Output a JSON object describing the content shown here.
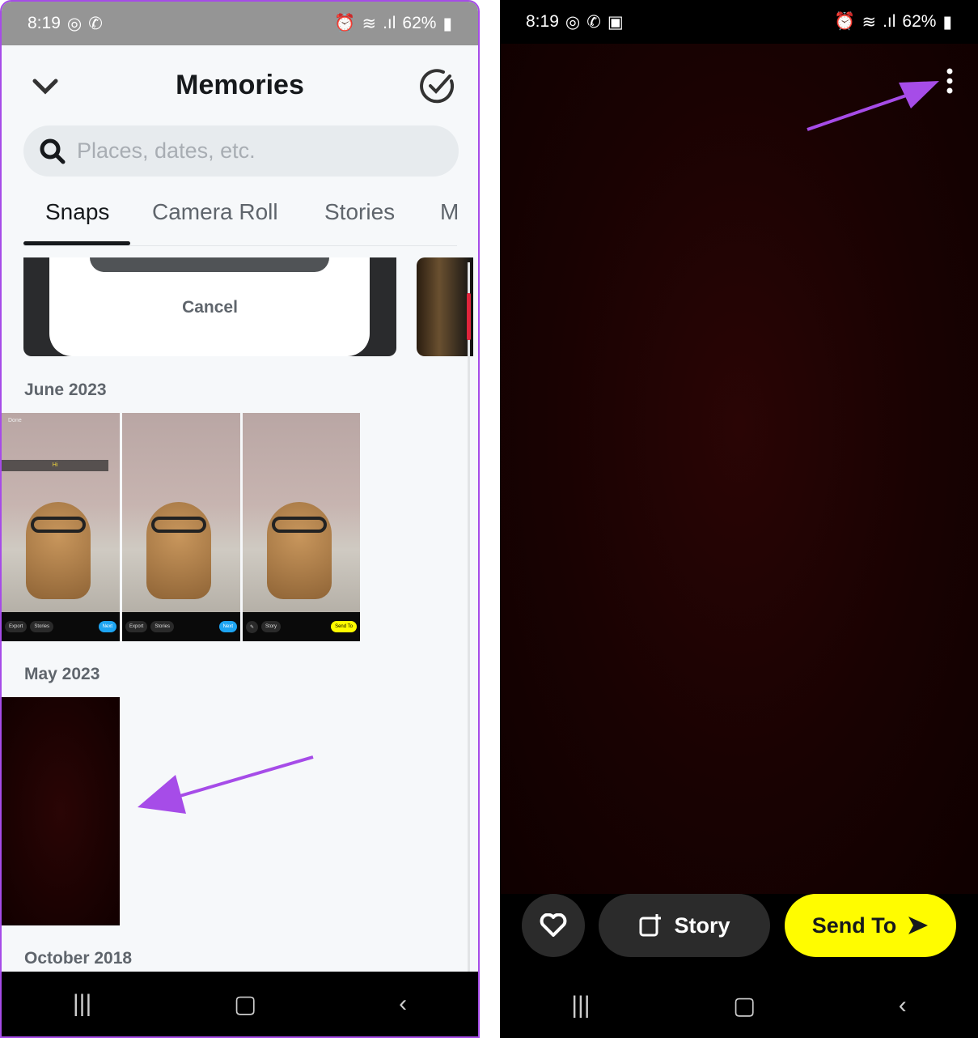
{
  "left": {
    "status": {
      "time": "8:19",
      "battery": "62%"
    },
    "header": {
      "title": "Memories"
    },
    "search": {
      "placeholder": "Places, dates, etc."
    },
    "tabs": [
      {
        "label": "Snaps",
        "active": true
      },
      {
        "label": "Camera Roll"
      },
      {
        "label": "Stories"
      },
      {
        "label": "M"
      }
    ],
    "top_partial": {
      "cancel_label": "Cancel"
    },
    "sections": [
      {
        "label": "June 2023",
        "thumbs": [
          {
            "top_label": "Done",
            "caption": "Hi",
            "buttons": [
              "Export",
              "Stories",
              "Next"
            ]
          },
          {
            "buttons": [
              "Export",
              "Stories",
              "Next"
            ]
          },
          {
            "buttons": [
              "Story",
              "Send To"
            ]
          }
        ]
      },
      {
        "label": "May 2023"
      },
      {
        "label": "October 2018"
      }
    ],
    "annotation_color": "#a64ce8"
  },
  "right": {
    "status": {
      "time": "8:19",
      "battery": "62%"
    },
    "actions": {
      "story_label": "Story",
      "send_label": "Send To"
    },
    "colors": {
      "send_button": "#fffc00",
      "annotation": "#a64ce8"
    }
  }
}
